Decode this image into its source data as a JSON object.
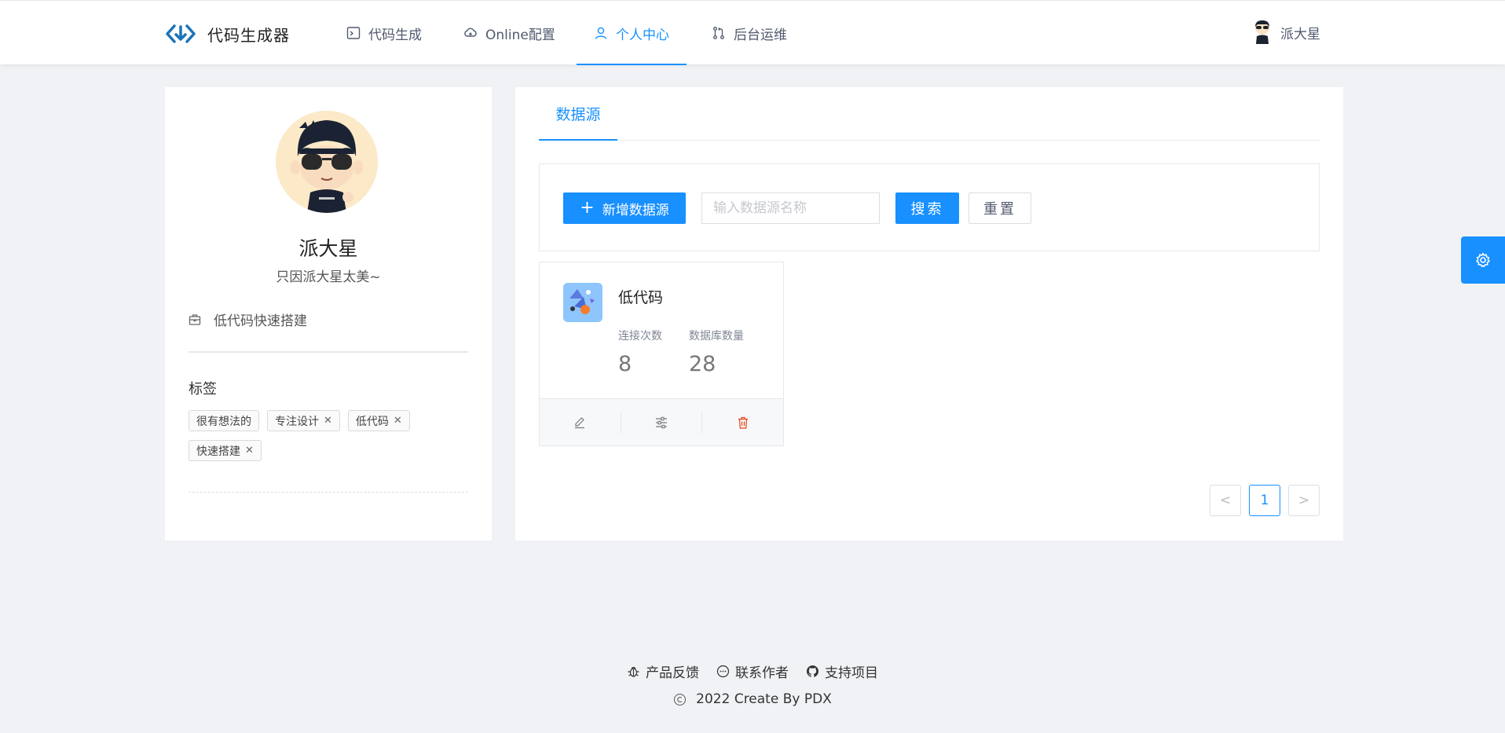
{
  "app": {
    "brand": "代码生成器"
  },
  "nav": {
    "items": [
      {
        "label": "代码生成",
        "icon": "terminal-icon"
      },
      {
        "label": "Online配置",
        "icon": "cloud-icon"
      },
      {
        "label": "个人中心",
        "icon": "user-icon",
        "active": true
      },
      {
        "label": "后台运维",
        "icon": "git-pull-icon"
      }
    ]
  },
  "header": {
    "username": "派大星"
  },
  "profile": {
    "name": "派大星",
    "motto": "只因派大星太美~",
    "company": "低代码快速搭建",
    "tags_title": "标签",
    "tags": [
      {
        "label": "很有想法的",
        "closable": false
      },
      {
        "label": "专注设计",
        "closable": true
      },
      {
        "label": "低代码",
        "closable": true
      },
      {
        "label": "快速搭建",
        "closable": true
      }
    ]
  },
  "datasource": {
    "tab": "数据源",
    "add_label": "新增数据源",
    "search_placeholder": "输入数据源名称",
    "search_label": "搜索",
    "reset_label": "重置",
    "cards": [
      {
        "name": "低代码",
        "conn_label": "连接次数",
        "conn_count": "8",
        "db_label": "数据库数量",
        "db_count": "28"
      }
    ],
    "pagination": {
      "prev": "<",
      "current": "1",
      "next": ">"
    }
  },
  "footer": {
    "feedback": "产品反馈",
    "contact": "联系作者",
    "support": "支持项目",
    "copyright": "2022 Create By PDX"
  },
  "colors": {
    "primary": "#1890ff",
    "background": "#f0f2f5",
    "danger": "#ed4014"
  }
}
